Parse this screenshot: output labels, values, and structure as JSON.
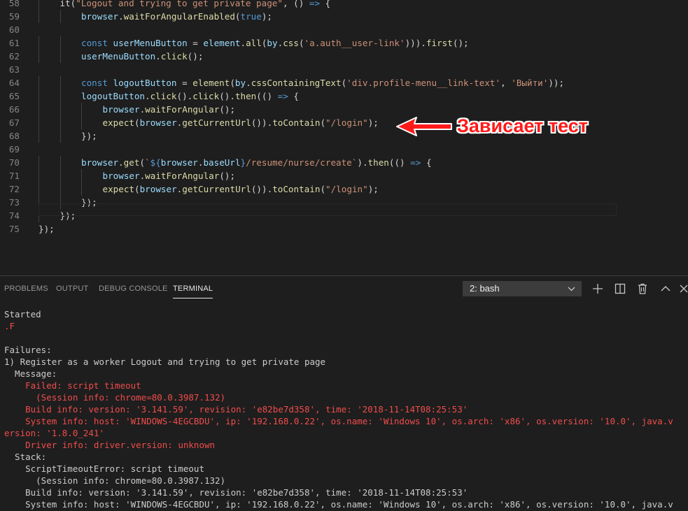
{
  "editor": {
    "lines": [
      {
        "n": "58",
        "tokens": [
          [
            "pu",
            "it("
          ],
          [
            "st",
            "\"Logout and trying to get private page\""
          ],
          [
            "pu",
            ", () "
          ],
          [
            "kw",
            "=>"
          ],
          [
            "pu",
            " {"
          ]
        ],
        "indent": 1
      },
      {
        "n": "59",
        "tokens": [
          [
            "vr",
            "browser"
          ],
          [
            "pu",
            "."
          ],
          [
            "fn",
            "waitForAngularEnabled"
          ],
          [
            "pu",
            "("
          ],
          [
            "kw",
            "true"
          ],
          [
            "pu",
            ");"
          ]
        ],
        "indent": 2
      },
      {
        "n": "60",
        "tokens": [],
        "indent": 0
      },
      {
        "n": "61",
        "tokens": [
          [
            "kw",
            "const "
          ],
          [
            "vr",
            "userMenuButton"
          ],
          [
            "pu",
            " = "
          ],
          [
            "vr",
            "element"
          ],
          [
            "pu",
            "."
          ],
          [
            "fn",
            "all"
          ],
          [
            "pu",
            "("
          ],
          [
            "vr",
            "by"
          ],
          [
            "pu",
            "."
          ],
          [
            "fn",
            "css"
          ],
          [
            "pu",
            "("
          ],
          [
            "st",
            "'a.auth__user-link'"
          ],
          [
            "pu",
            ")))."
          ],
          [
            "fn",
            "first"
          ],
          [
            "pu",
            "();"
          ]
        ],
        "indent": 2
      },
      {
        "n": "62",
        "tokens": [
          [
            "vr",
            "userMenuButton"
          ],
          [
            "pu",
            "."
          ],
          [
            "fn",
            "click"
          ],
          [
            "pu",
            "();"
          ]
        ],
        "indent": 2
      },
      {
        "n": "63",
        "tokens": [],
        "indent": 0
      },
      {
        "n": "64",
        "tokens": [
          [
            "kw",
            "const "
          ],
          [
            "vr",
            "logoutButton"
          ],
          [
            "pu",
            " = "
          ],
          [
            "fn",
            "element"
          ],
          [
            "pu",
            "("
          ],
          [
            "vr",
            "by"
          ],
          [
            "pu",
            "."
          ],
          [
            "fn",
            "cssContainingText"
          ],
          [
            "pu",
            "("
          ],
          [
            "st",
            "'div.profile-menu__link-text'"
          ],
          [
            "pu",
            ", "
          ],
          [
            "st",
            "'Выйти'"
          ],
          [
            "pu",
            "));"
          ]
        ],
        "indent": 2
      },
      {
        "n": "65",
        "tokens": [
          [
            "vr",
            "logoutButton"
          ],
          [
            "pu",
            "."
          ],
          [
            "fn",
            "click"
          ],
          [
            "pu",
            "()."
          ],
          [
            "fn",
            "click"
          ],
          [
            "pu",
            "()."
          ],
          [
            "fn",
            "then"
          ],
          [
            "pu",
            "(() "
          ],
          [
            "kw",
            "=>"
          ],
          [
            "pu",
            " {"
          ]
        ],
        "indent": 2
      },
      {
        "n": "66",
        "tokens": [
          [
            "vr",
            "browser"
          ],
          [
            "pu",
            "."
          ],
          [
            "fn",
            "waitForAngular"
          ],
          [
            "pu",
            "();"
          ]
        ],
        "indent": 3
      },
      {
        "n": "67",
        "tokens": [
          [
            "fn",
            "expect"
          ],
          [
            "pu",
            "("
          ],
          [
            "vr",
            "browser"
          ],
          [
            "pu",
            "."
          ],
          [
            "fn",
            "getCurrentUrl"
          ],
          [
            "pu",
            "())."
          ],
          [
            "fn",
            "toContain"
          ],
          [
            "pu",
            "("
          ],
          [
            "st",
            "\"/login\""
          ],
          [
            "pu",
            ");"
          ]
        ],
        "indent": 3
      },
      {
        "n": "68",
        "tokens": [
          [
            "pu",
            "});"
          ]
        ],
        "indent": 2
      },
      {
        "n": "69",
        "tokens": [],
        "indent": 0
      },
      {
        "n": "70",
        "tokens": [
          [
            "vr",
            "browser"
          ],
          [
            "pu",
            "."
          ],
          [
            "fn",
            "get"
          ],
          [
            "pu",
            "("
          ],
          [
            "st",
            "`"
          ],
          [
            "kw",
            "${"
          ],
          [
            "vr",
            "browser"
          ],
          [
            "pu",
            "."
          ],
          [
            "vr",
            "baseUrl"
          ],
          [
            "kw",
            "}"
          ],
          [
            "st",
            "/resume/nurse/create`"
          ],
          [
            "pu",
            ")."
          ],
          [
            "fn",
            "then"
          ],
          [
            "pu",
            "(() "
          ],
          [
            "kw",
            "=>"
          ],
          [
            "pu",
            " {"
          ]
        ],
        "indent": 2
      },
      {
        "n": "71",
        "tokens": [
          [
            "vr",
            "browser"
          ],
          [
            "pu",
            "."
          ],
          [
            "fn",
            "waitForAngular"
          ],
          [
            "pu",
            "();"
          ]
        ],
        "indent": 3
      },
      {
        "n": "72",
        "tokens": [
          [
            "fn",
            "expect"
          ],
          [
            "pu",
            "("
          ],
          [
            "vr",
            "browser"
          ],
          [
            "pu",
            "."
          ],
          [
            "fn",
            "getCurrentUrl"
          ],
          [
            "pu",
            "())."
          ],
          [
            "fn",
            "toContain"
          ],
          [
            "pu",
            "("
          ],
          [
            "st",
            "\"/login\""
          ],
          [
            "pu",
            ");"
          ]
        ],
        "indent": 3
      },
      {
        "n": "73",
        "tokens": [
          [
            "pu",
            "});"
          ]
        ],
        "indent": 2
      },
      {
        "n": "74",
        "tokens": [
          [
            "pu",
            "});"
          ]
        ],
        "indent": 1
      },
      {
        "n": "75",
        "tokens": [
          [
            "pu",
            "});"
          ]
        ],
        "indent": 0
      }
    ]
  },
  "annotation": {
    "text": "Зависает тест",
    "color": "#ff1a1a"
  },
  "panel": {
    "tabs": [
      "PROBLEMS",
      "OUTPUT",
      "DEBUG CONSOLE",
      "TERMINAL"
    ],
    "active_tab": "TERMINAL",
    "terminal_select": "2: bash",
    "icons": [
      "plus-icon",
      "split-icon",
      "trash-icon",
      "chevron-up-icon",
      "close-icon"
    ]
  },
  "terminal": {
    "lines": [
      {
        "text": "Started",
        "err": false
      },
      {
        "text": ".F",
        "err": true
      },
      {
        "text": "",
        "err": false
      },
      {
        "text": "Failures:",
        "err": false
      },
      {
        "text": "1) Register as a worker Logout and trying to get private page",
        "err": false
      },
      {
        "text": "  Message:",
        "err": false
      },
      {
        "text": "    Failed: script timeout",
        "err": true
      },
      {
        "text": "      (Session info: chrome=80.0.3987.132)",
        "err": true
      },
      {
        "text": "    Build info: version: '3.141.59', revision: 'e82be7d358', time: '2018-11-14T08:25:53'",
        "err": true
      },
      {
        "text": "    System info: host: 'WINDOWS-4EGCBDU', ip: '192.168.0.22', os.name: 'Windows 10', os.arch: 'x86', os.version: '10.0', java.v",
        "err": true
      },
      {
        "text": "ersion: '1.8.0_241'",
        "err": true
      },
      {
        "text": "    Driver info: driver.version: unknown",
        "err": true
      },
      {
        "text": "  Stack:",
        "err": false
      },
      {
        "text": "    ScriptTimeoutError: script timeout",
        "err": false
      },
      {
        "text": "      (Session info: chrome=80.0.3987.132)",
        "err": false
      },
      {
        "text": "    Build info: version: '3.141.59', revision: 'e82be7d358', time: '2018-11-14T08:25:53'",
        "err": false
      },
      {
        "text": "    System info: host: 'WINDOWS-4EGCBDU', ip: '192.168.0.22', os.name: 'Windows 10', os.arch: 'x86', os.version: '10.0', java.v",
        "err": false
      }
    ]
  }
}
